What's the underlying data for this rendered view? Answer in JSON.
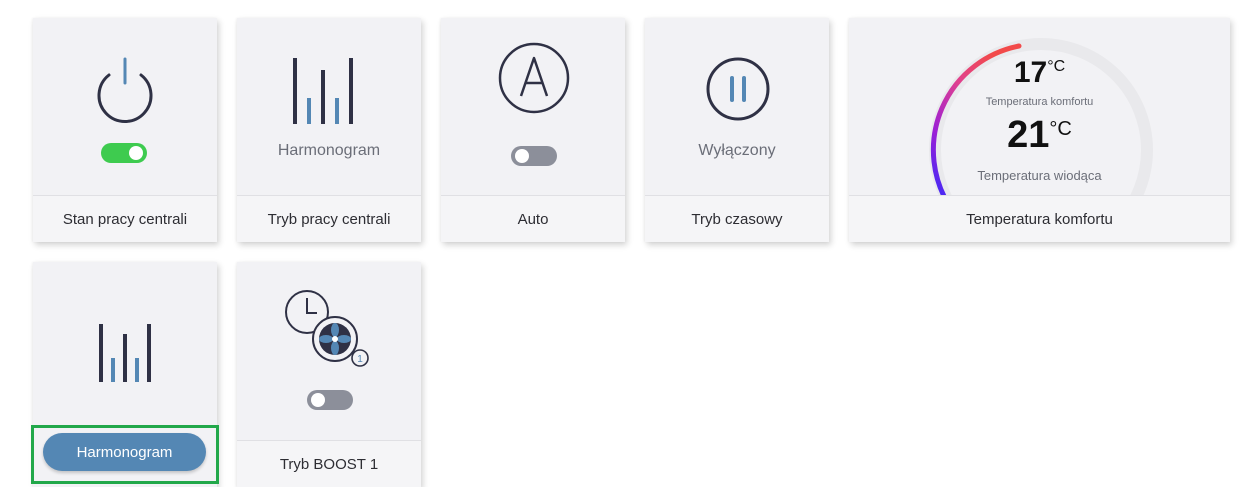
{
  "tiles": {
    "power": {
      "label": "Stan pracy centrali",
      "toggle_on": true
    },
    "mode": {
      "label": "Tryb pracy centrali",
      "value": "Harmonogram"
    },
    "auto": {
      "label": "Auto",
      "toggle_on": false
    },
    "timer": {
      "label": "Tryb czasowy",
      "value": "Wyłączony"
    },
    "temperature": {
      "label": "Temperatura komfortu",
      "comfort_value": "17",
      "comfort_unit": "°C",
      "comfort_caption": "Temperatura komfortu",
      "lead_value": "21",
      "lead_unit": "°C",
      "lead_caption": "Temperatura wiodąca"
    },
    "schedule": {
      "button_label": "Harmonogram"
    },
    "boost": {
      "label": "Tryb BOOST 1",
      "toggle_on": false,
      "badge": "1"
    }
  },
  "colors": {
    "accent_blue": "#5487b4",
    "toggle_on": "#3ecb4f",
    "toggle_off": "#8c8f9a",
    "icon_dark": "#2f3145",
    "focus_green": "#22a84a"
  },
  "icons": [
    "power-icon",
    "schedule-bars-icon",
    "auto-a-icon",
    "pause-icon",
    "temperature-gauge",
    "clock-fan-icon"
  ]
}
